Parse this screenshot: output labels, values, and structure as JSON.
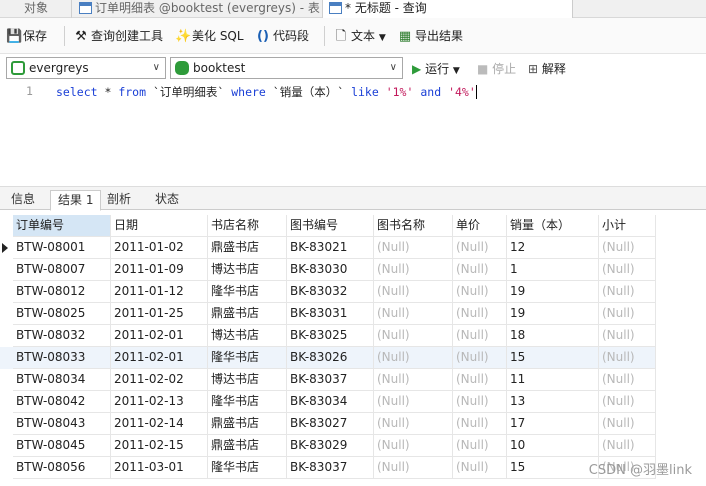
{
  "tabs": [
    {
      "label": "对象"
    },
    {
      "label": "订单明细表 @booktest (evergreys) - 表"
    },
    {
      "label": "* 无标题 - 查询"
    }
  ],
  "toolbar": {
    "save": "保存",
    "query_builder": "查询创建工具",
    "beautify_sql": "美化 SQL",
    "code_snippet": "代码段",
    "text": "文本",
    "export": "导出结果"
  },
  "connection": {
    "server": "evergreys",
    "database": "booktest",
    "run": "运行",
    "stop": "停止",
    "explain": "解释"
  },
  "editor": {
    "line_number": "1",
    "tokens": [
      {
        "t": "select",
        "k": "kw"
      },
      {
        "t": " * ",
        "k": ""
      },
      {
        "t": "from",
        "k": "kw"
      },
      {
        "t": " `订单明细表` ",
        "k": ""
      },
      {
        "t": "where",
        "k": "kw"
      },
      {
        "t": " `销量（本）` ",
        "k": ""
      },
      {
        "t": "like",
        "k": "kw"
      },
      {
        "t": " ",
        "k": ""
      },
      {
        "t": "'1%'",
        "k": "str"
      },
      {
        "t": " ",
        "k": ""
      },
      {
        "t": "and",
        "k": "kw"
      },
      {
        "t": " ",
        "k": ""
      },
      {
        "t": "'4%'",
        "k": "str"
      }
    ]
  },
  "result_tabs": [
    "信息",
    "结果 1",
    "剖析",
    "状态"
  ],
  "active_result_tab": 1,
  "table": {
    "columns": [
      "订单编号",
      "日期",
      "书店名称",
      "图书编号",
      "图书名称",
      "单价",
      "销量（本）",
      "小计"
    ],
    "rows": [
      [
        "BTW-08001",
        "2011-01-02",
        "鼎盛书店",
        "BK-83021",
        "(Null)",
        "(Null)",
        "12",
        "(Null)"
      ],
      [
        "BTW-08007",
        "2011-01-09",
        "博达书店",
        "BK-83030",
        "(Null)",
        "(Null)",
        "1",
        "(Null)"
      ],
      [
        "BTW-08012",
        "2011-01-12",
        "隆华书店",
        "BK-83032",
        "(Null)",
        "(Null)",
        "19",
        "(Null)"
      ],
      [
        "BTW-08025",
        "2011-01-25",
        "鼎盛书店",
        "BK-83031",
        "(Null)",
        "(Null)",
        "19",
        "(Null)"
      ],
      [
        "BTW-08032",
        "2011-02-01",
        "博达书店",
        "BK-83025",
        "(Null)",
        "(Null)",
        "18",
        "(Null)"
      ],
      [
        "BTW-08033",
        "2011-02-01",
        "隆华书店",
        "BK-83026",
        "(Null)",
        "(Null)",
        "15",
        "(Null)"
      ],
      [
        "BTW-08034",
        "2011-02-02",
        "博达书店",
        "BK-83037",
        "(Null)",
        "(Null)",
        "11",
        "(Null)"
      ],
      [
        "BTW-08042",
        "2011-02-13",
        "隆华书店",
        "BK-83034",
        "(Null)",
        "(Null)",
        "13",
        "(Null)"
      ],
      [
        "BTW-08043",
        "2011-02-14",
        "鼎盛书店",
        "BK-83027",
        "(Null)",
        "(Null)",
        "17",
        "(Null)"
      ],
      [
        "BTW-08045",
        "2011-02-15",
        "鼎盛书店",
        "BK-83029",
        "(Null)",
        "(Null)",
        "10",
        "(Null)"
      ],
      [
        "BTW-08056",
        "2011-03-01",
        "隆华书店",
        "BK-83037",
        "(Null)",
        "(Null)",
        "15",
        "(Null)"
      ]
    ]
  },
  "selected_row": 5,
  "watermark": "CSDN @羽墨link",
  "colors": {
    "keyword": "#1a3fd6",
    "string": "#c2185b",
    "null_text": "#b8b8b8",
    "selected_header": "#d5e6f5"
  }
}
